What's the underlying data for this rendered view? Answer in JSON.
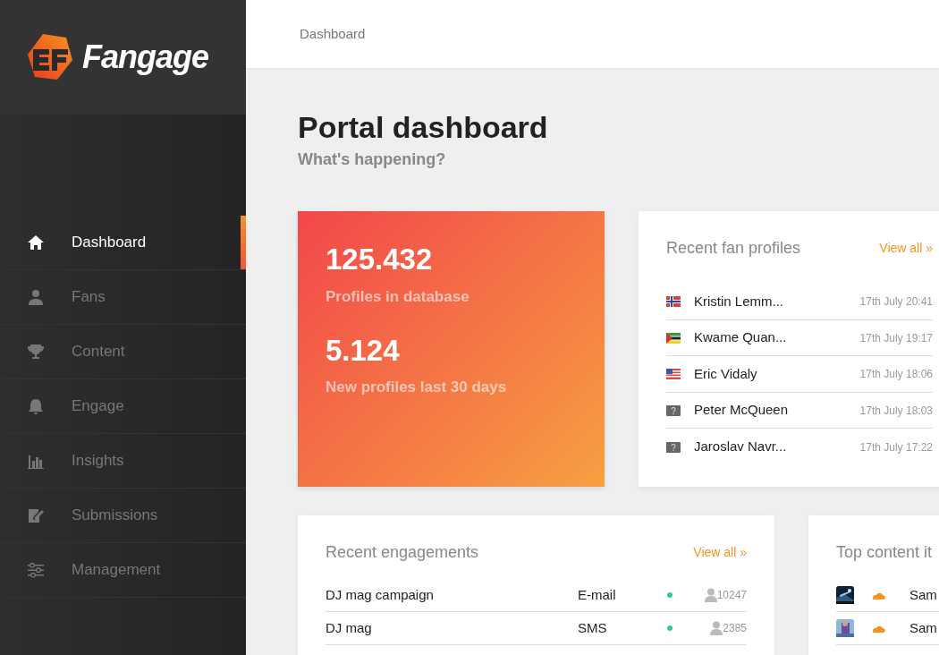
{
  "brand": {
    "name": "Fangage"
  },
  "sidebar": {
    "items": [
      {
        "label": "Dashboard",
        "kind": "home",
        "selected": true
      },
      {
        "label": "Fans",
        "kind": "person",
        "selected": false
      },
      {
        "label": "Content",
        "kind": "trophy",
        "selected": false
      },
      {
        "label": "Engage",
        "kind": "bell",
        "selected": false
      },
      {
        "label": "Insights",
        "kind": "bars",
        "selected": false
      },
      {
        "label": "Submissions",
        "kind": "note",
        "selected": false
      },
      {
        "label": "Management",
        "kind": "sliders",
        "selected": false
      }
    ]
  },
  "breadcrumb": "Dashboard",
  "page": {
    "title": "Portal dashboard",
    "subtitle": "What's happening?"
  },
  "stats": [
    {
      "value": "125.432",
      "label": "Profiles in database"
    },
    {
      "value": "5.124",
      "label": "New profiles last 30 days"
    }
  ],
  "fan_profiles": {
    "title": "Recent fan profiles",
    "link": "View all »",
    "rows": [
      {
        "kind": "norway",
        "name": "Kristin Lemm...",
        "time": "17th July 20:41"
      },
      {
        "kind": "mozambique",
        "name": "Kwame Quan...",
        "time": "17th July 19:17"
      },
      {
        "kind": "usa",
        "name": "Eric Vidaly",
        "time": "17th July 18:06"
      },
      {
        "kind": "unknown",
        "name": "Peter McQueen",
        "time": "17th July 18:03"
      },
      {
        "kind": "unknown",
        "name": "Jaroslav Navr...",
        "time": "17th July 17:22"
      }
    ]
  },
  "engagements": {
    "title": "Recent engagements",
    "link": "View all »",
    "rows": [
      {
        "name": "DJ mag campaign",
        "channel": "E-mail",
        "color": "#2ecc8f",
        "count": "10247"
      },
      {
        "name": "DJ mag",
        "channel": "SMS",
        "color": "#2ecc8f",
        "count": "2385"
      }
    ]
  },
  "top_content": {
    "title": "Top content it",
    "rows": [
      {
        "kind": "picture",
        "label": "Sam"
      },
      {
        "kind": "picture",
        "label": "Sam"
      }
    ]
  }
}
